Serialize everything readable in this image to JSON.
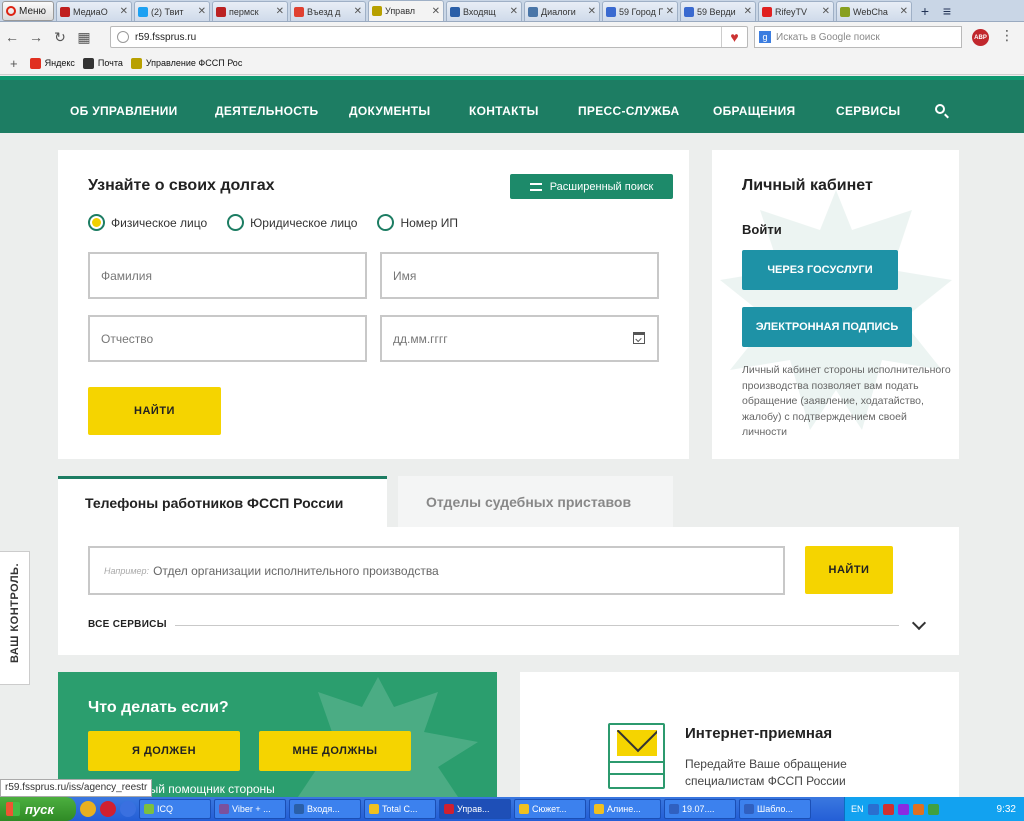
{
  "browser": {
    "menu_label": "Меню",
    "tabs": [
      {
        "title": "МедиаО",
        "color": "#c02020"
      },
      {
        "title": "(2) Твит",
        "color": "#1da1f2"
      },
      {
        "title": "пермск",
        "color": "#b22"
      },
      {
        "title": "Въезд д",
        "color": "#e04030"
      },
      {
        "title": "Управл",
        "color": "#b8a000",
        "active": true
      },
      {
        "title": "Входящ",
        "color": "#2a5fa8"
      },
      {
        "title": "Диалоги",
        "color": "#4a76a8"
      },
      {
        "title": "59 Город П",
        "color": "#3a6ad0"
      },
      {
        "title": "59 Верди",
        "color": "#3a6ad0"
      },
      {
        "title": "RifeyTV",
        "color": "#e02020"
      },
      {
        "title": "WebCha",
        "color": "#88a020"
      }
    ],
    "url": "r59.fssprus.ru",
    "search_placeholder": "Искать в Google поиск",
    "abp": "ABP",
    "bookmarks": [
      {
        "label": "Яндекс",
        "color": "#e03020"
      },
      {
        "label": "Почта",
        "color": "#333333"
      },
      {
        "label": "Управление ФССП Рос",
        "color": "#b8a000"
      }
    ],
    "status_url": "r59.fssprus.ru/iss/agency_reestr"
  },
  "nav": {
    "items": [
      "ОБ УПРАВЛЕНИИ",
      "ДЕЯТЕЛЬНОСТЬ",
      "ДОКУМЕНТЫ",
      "КОНТАКТЫ",
      "ПРЕСС-СЛУЖБА",
      "ОБРАЩЕНИЯ",
      "СЕРВИСЫ"
    ]
  },
  "debts": {
    "title": "Узнайте о своих долгах",
    "advanced_search": "Расширенный поиск",
    "radios": [
      {
        "label": "Физическое лицо",
        "checked": true
      },
      {
        "label": "Юридическое лицо",
        "checked": false
      },
      {
        "label": "Номер ИП",
        "checked": false
      }
    ],
    "fields": {
      "last_name": "Фамилия",
      "first_name": "Имя",
      "middle_name": "Отчество",
      "birth_date": "дд.мм.гггг"
    },
    "find_button": "НАЙТИ"
  },
  "cabinet": {
    "title": "Личный кабинет",
    "login": "Войти",
    "gosuslugi_button": "ЧЕРЕЗ ГОСУСЛУГИ",
    "signature_button": "ЭЛЕКТРОННАЯ ПОДПИСЬ",
    "description": "Личный кабинет стороны исполнительного производства позволяет вам подать обращение (заявление, ходатайство, жалобу) с подтверждением своей личности"
  },
  "phones": {
    "tab_active": "Телефоны работников ФССП России",
    "tab_inactive": "Отделы судебных приставов",
    "hint": "Например:",
    "placeholder": "Отдел организации исполнительного производства",
    "find_button": "НАЙТИ",
    "all_services": "ВСЕ СЕРВИСЫ"
  },
  "side_control": "ВАШ КОНТРОЛЬ.",
  "what_if": {
    "title": "Что делать если?",
    "i_owe": "Я ДОЛЖЕН",
    "owed_to_me": "МНЕ ДОЛЖНЫ",
    "helper": "ный помощник стороны"
  },
  "reception": {
    "title": "Интернет-приемная",
    "text": "Передайте Ваше обращение специалистам ФССП России"
  },
  "taskbar": {
    "start": "пуск",
    "tasks": [
      {
        "title": "ICQ",
        "color": "#7cc040"
      },
      {
        "title": "Viber + ...",
        "color": "#7b519d"
      },
      {
        "title": "Входя...",
        "color": "#2a5fa8"
      },
      {
        "title": "Total C...",
        "color": "#f0c020"
      },
      {
        "title": "Управ...",
        "color": "#d02030",
        "active": true
      },
      {
        "title": "Сюжет...",
        "color": "#f0c020"
      },
      {
        "title": "Алине...",
        "color": "#f0c020"
      },
      {
        "title": "19.07....",
        "color": "#3060c0"
      },
      {
        "title": "Шабло...",
        "color": "#3060c0"
      }
    ],
    "lang": "EN",
    "clock": "9:32"
  }
}
